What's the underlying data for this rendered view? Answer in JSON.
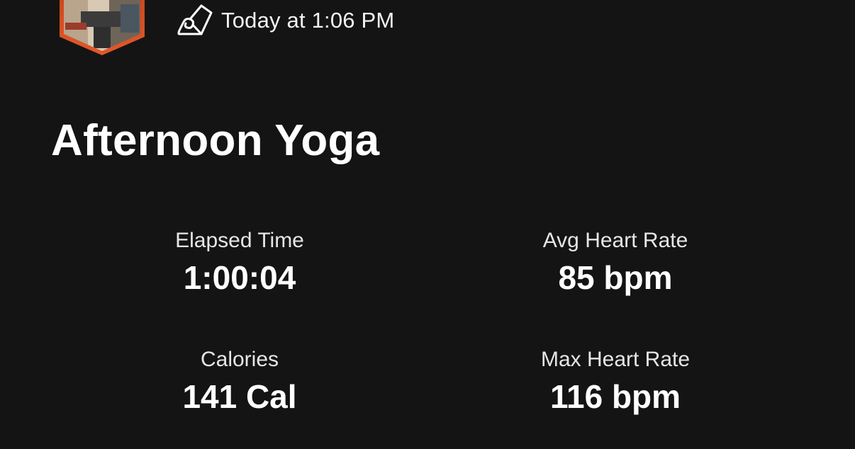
{
  "header": {
    "avatar_icon": "user-avatar-hexagon",
    "avatar_border_color": "#e2582b",
    "activity_icon": "yoga-mat-icon",
    "timestamp": "Today at 1:06 PM"
  },
  "activity": {
    "title": "Afternoon Yoga"
  },
  "stats": {
    "elapsed_time": {
      "label": "Elapsed Time",
      "value": "1:00:04"
    },
    "avg_heart_rate": {
      "label": "Avg Heart Rate",
      "value": "85 bpm"
    },
    "calories": {
      "label": "Calories",
      "value": "141 Cal"
    },
    "max_heart_rate": {
      "label": "Max Heart Rate",
      "value": "116 bpm"
    }
  },
  "colors": {
    "background": "#141414",
    "text": "#ffffff",
    "accent": "#e2582b"
  }
}
